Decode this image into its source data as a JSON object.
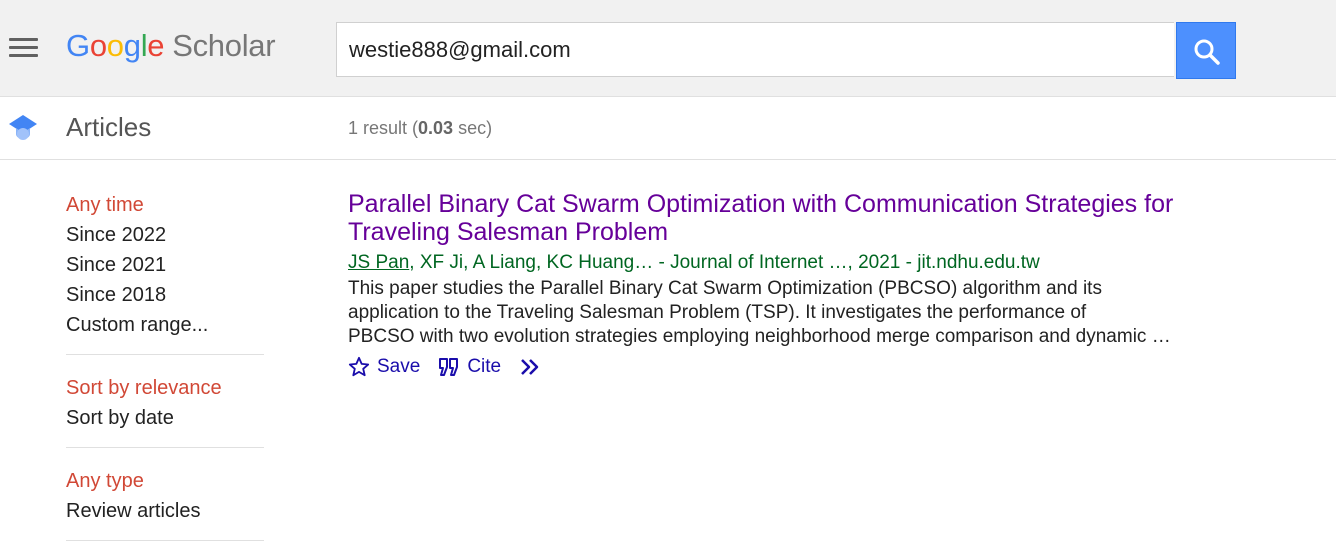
{
  "app": {
    "logo_google": [
      "G",
      "o",
      "o",
      "g",
      "l",
      "e"
    ],
    "logo_scholar": "Scholar"
  },
  "search": {
    "query": "westie888@gmail.com"
  },
  "subheader": {
    "section_title": "Articles",
    "count_prefix": "1 result (",
    "count_time": "0.03",
    "count_suffix": " sec)"
  },
  "sidebar": {
    "time_filters": [
      "Any time",
      "Since 2022",
      "Since 2021",
      "Since 2018",
      "Custom range..."
    ],
    "sort_filters": [
      "Sort by relevance",
      "Sort by date"
    ],
    "type_filters": [
      "Any type",
      "Review articles"
    ]
  },
  "result": {
    "title": "Parallel Binary Cat Swarm Optimization with Communication Strategies for Traveling Salesman Problem",
    "author_link": "JS Pan",
    "meta_rest": ", XF Ji, A Liang, KC Huang… - Journal of Internet …, 2021 - jit.ndhu.edu.tw",
    "snippet_lines": [
      "This paper studies the Parallel Binary Cat Swarm Optimization (PBCSO) algorithm and its",
      "application to the Traveling Salesman Problem (TSP). It investigates the performance of",
      "PBCSO with two evolution strategies employing neighborhood merge comparison and dynamic …"
    ],
    "save_label": "Save",
    "cite_label": "Cite"
  },
  "colors": {
    "accent_blue": "#4d90fe",
    "active_filter": "#d14836",
    "visited_link": "#660099",
    "meta_green": "#006621",
    "action_blue": "#1a0dab"
  },
  "icons": [
    "menu-icon",
    "search-icon",
    "graduation-cap-icon",
    "star-icon",
    "quote-icon",
    "double-chevron-icon"
  ]
}
